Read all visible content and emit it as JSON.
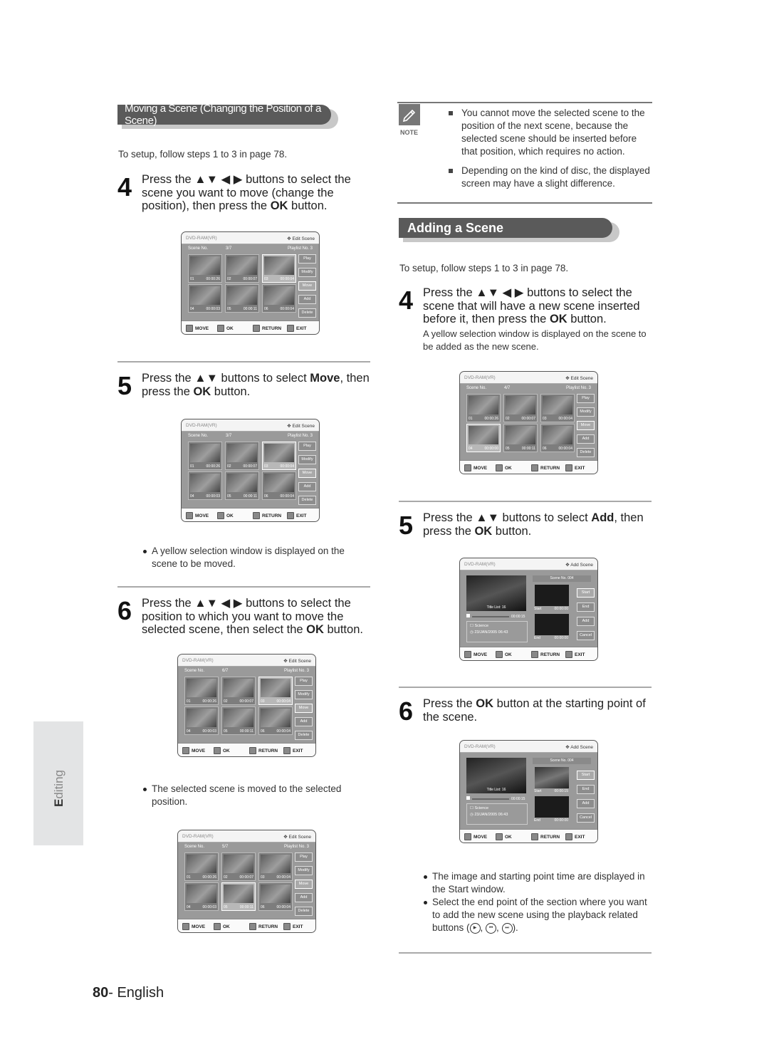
{
  "page": {
    "number": "80",
    "language": "English",
    "side_tab": "Editing"
  },
  "left": {
    "section_title": "Moving a Scene (Changing the Position of a Scene)",
    "setup_text": "To setup, follow steps 1 to 3 in page 78.",
    "step4": {
      "num": "4",
      "text_a": "Press the ▲▼ ◀ ▶ buttons to select the scene you want to move (change the position), then press the ",
      "bold": "OK",
      "text_b": " button."
    },
    "step5": {
      "num": "5",
      "text_a": "Press the ▲▼ buttons to select ",
      "bold1": "Move",
      "text_b": ", then press the ",
      "bold2": "OK",
      "text_c": " button."
    },
    "bullet5": "A yellow selection window is displayed on the scene to be moved.",
    "step6": {
      "num": "6",
      "text_a": "Press the ▲▼ ◀ ▶ buttons to select the position to which you want to move the selected scene, then select the ",
      "bold": "OK",
      "text_b": " button."
    },
    "bullet6": "The selected scene is moved to the selected position."
  },
  "right": {
    "notes": [
      "You cannot move the selected scene to the position of the next scene, because the selected scene should be inserted before that position, which requires no action.",
      "Depending on the kind of disc, the displayed screen may have a slight difference."
    ],
    "note_label": "NOTE",
    "section_title": "Adding a Scene",
    "setup_text": "To setup, follow steps 1 to 3 in page 78.",
    "step4": {
      "num": "4",
      "text_a": "Press the ▲▼ ◀ ▶ buttons to select the scene that will have a new scene inserted before it, then press the ",
      "bold": "OK",
      "text_b": " button.",
      "sub": "A yellow selection window is displayed on the scene to be added as the new scene."
    },
    "step5": {
      "num": "5",
      "text_a": "Press the ▲▼ buttons to select ",
      "bold1": "Add",
      "text_b": ", then press the ",
      "bold2": "OK",
      "text_c": " button."
    },
    "step6": {
      "num": "6",
      "text_a": "Press the ",
      "bold": "OK",
      "text_b": " button at the starting point of the scene."
    },
    "bullets": [
      "The image and starting point time are displayed in the Start window.",
      "Select the end point of the section where you want to add the new scene using the playback related buttons ("
    ],
    "bullet_tail": ")."
  },
  "edit_screen": {
    "disc": "DVD-RAM(VR)",
    "mode": "✥ Edit Scene",
    "scene_label": "Scene No.",
    "playlist": "Playlist No.  3",
    "buttons": [
      "Play",
      "Modify",
      "Move",
      "Add",
      "Delete"
    ],
    "footer": [
      "MOVE",
      "OK",
      "RETURN",
      "EXIT"
    ]
  },
  "screens": [
    {
      "counter": "3/7",
      "scenes": [
        [
          "01",
          "00:00:26"
        ],
        [
          "02",
          "00:00:07"
        ],
        [
          "03",
          "00:00:04"
        ],
        [
          "04",
          "00:00:03"
        ],
        [
          "05",
          "00:00:11"
        ],
        [
          "06",
          "00:00:04"
        ]
      ],
      "selected": 2
    },
    {
      "counter": "3/7",
      "scenes": [
        [
          "01",
          "00:00:26"
        ],
        [
          "02",
          "00:00:07"
        ],
        [
          "03",
          "00:00:04"
        ],
        [
          "04",
          "00:00:03"
        ],
        [
          "05",
          "00:00:11"
        ],
        [
          "06",
          "00:00:04"
        ]
      ],
      "selected": 2
    },
    {
      "counter": "6/7",
      "scenes": [
        [
          "01",
          "00:00:26"
        ],
        [
          "02",
          "00:00:07"
        ],
        [
          "03",
          "00:00:04"
        ],
        [
          "04",
          "00:00:03"
        ],
        [
          "05",
          "00:00:11"
        ],
        [
          "06",
          "00:00:04"
        ]
      ],
      "selected": 2
    },
    {
      "counter": "5/7",
      "scenes": [
        [
          "01",
          "00:00:26"
        ],
        [
          "02",
          "00:00:07"
        ],
        [
          "03",
          "00:00:04"
        ],
        [
          "04",
          "00:00:03"
        ],
        [
          "05",
          "00:00:11"
        ],
        [
          "06",
          "00:00:04"
        ]
      ],
      "selected": 4
    },
    {
      "counter": "4/7",
      "scenes": [
        [
          "01",
          "00:00:26"
        ],
        [
          "02",
          "00:00:07"
        ],
        [
          "03",
          "00:00:04"
        ],
        [
          "04",
          "00:00:00"
        ],
        [
          "05",
          "00:00:11"
        ],
        [
          "06",
          "00:00:04"
        ]
      ],
      "selected": 3
    }
  ],
  "add_screen": {
    "disc": "DVD-RAM(VR)",
    "mode": "✥ Add Scene",
    "scene_no": "Scene No. 004",
    "title_list": "Title List: 16",
    "time": "00:00:15",
    "title": "Science",
    "date": "23/JAN/2005 06:43",
    "start_label": "Start",
    "end_label": "End",
    "buttons": [
      "Start",
      "End",
      "Add",
      "Cancel"
    ],
    "footer": [
      "MOVE",
      "OK",
      "RETURN",
      "EXIT"
    ],
    "start_times": [
      "00:00:00",
      "00:00:15"
    ],
    "end_time": "00:00:00"
  }
}
